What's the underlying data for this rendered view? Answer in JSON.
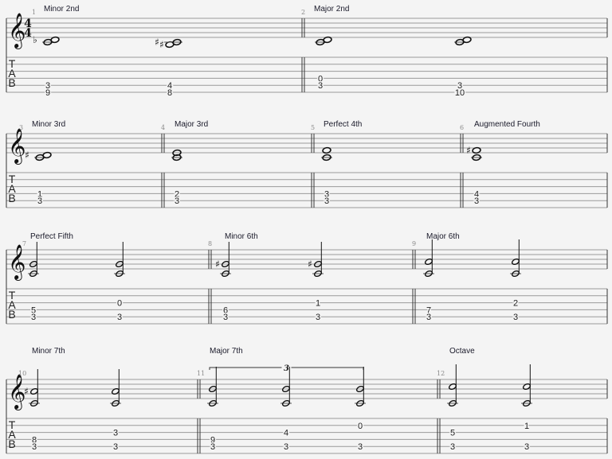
{
  "clef": "treble-clef-icon",
  "time_signature": {
    "top": "4",
    "bottom": "4"
  },
  "tab_letters": [
    "T",
    "A",
    "B"
  ],
  "measures": [
    {
      "number": "1",
      "label": "Minor 2nd",
      "duration": "whole",
      "chords": [
        {
          "notes": [
            "C4",
            "Db4"
          ],
          "frets": [
            {
              "string": 5,
              "fret": "3"
            },
            {
              "string": 6,
              "fret": "9"
            }
          ]
        },
        {
          "notes": [
            "B#3",
            "C#4"
          ],
          "frets": [
            {
              "string": 5,
              "fret": "4"
            },
            {
              "string": 6,
              "fret": "8"
            }
          ]
        }
      ]
    },
    {
      "number": "2",
      "label": "Major 2nd",
      "duration": "whole",
      "chords": [
        {
          "notes": [
            "C4",
            "D4"
          ],
          "frets": [
            {
              "string": 4,
              "fret": "0"
            },
            {
              "string": 5,
              "fret": "3"
            }
          ]
        },
        {
          "notes": [
            "C4",
            "D4"
          ],
          "frets": [
            {
              "string": 5,
              "fret": "3"
            },
            {
              "string": 6,
              "fret": "10"
            }
          ]
        }
      ]
    },
    {
      "number": "3",
      "label": "Minor 3rd",
      "duration": "whole",
      "chords": [
        {
          "notes": [
            "C4",
            "D#4"
          ],
          "frets": [
            {
              "string": 4,
              "fret": "1"
            },
            {
              "string": 5,
              "fret": "3"
            }
          ]
        }
      ]
    },
    {
      "number": "4",
      "label": "Major 3rd",
      "duration": "whole",
      "chords": [
        {
          "notes": [
            "C4",
            "E4"
          ],
          "frets": [
            {
              "string": 4,
              "fret": "2"
            },
            {
              "string": 5,
              "fret": "3"
            }
          ]
        }
      ]
    },
    {
      "number": "5",
      "label": "Perfect 4th",
      "duration": "whole",
      "chords": [
        {
          "notes": [
            "C4",
            "F4"
          ],
          "frets": [
            {
              "string": 4,
              "fret": "3"
            },
            {
              "string": 5,
              "fret": "3"
            }
          ]
        }
      ]
    },
    {
      "number": "6",
      "label": "Augmented Fourth",
      "duration": "whole",
      "chords": [
        {
          "notes": [
            "C4",
            "F#4"
          ],
          "frets": [
            {
              "string": 4,
              "fret": "4"
            },
            {
              "string": 5,
              "fret": "3"
            }
          ]
        }
      ]
    },
    {
      "number": "7",
      "label": "Perfect Fifth",
      "duration": "half",
      "chords": [
        {
          "notes": [
            "C4",
            "G4"
          ],
          "frets": [
            {
              "string": 4,
              "fret": "5"
            },
            {
              "string": 5,
              "fret": "3"
            }
          ]
        },
        {
          "notes": [
            "C4",
            "G4"
          ],
          "frets": [
            {
              "string": 3,
              "fret": "0"
            },
            {
              "string": 5,
              "fret": "3"
            }
          ]
        }
      ]
    },
    {
      "number": "8",
      "label": "Minor 6th",
      "duration": "half",
      "chords": [
        {
          "notes": [
            "C4",
            "G#4"
          ],
          "frets": [
            {
              "string": 4,
              "fret": "6"
            },
            {
              "string": 5,
              "fret": "3"
            }
          ]
        },
        {
          "notes": [
            "C4",
            "G#4"
          ],
          "frets": [
            {
              "string": 3,
              "fret": "1"
            },
            {
              "string": 5,
              "fret": "3"
            }
          ]
        }
      ]
    },
    {
      "number": "9",
      "label": "Major 6th",
      "duration": "half",
      "chords": [
        {
          "notes": [
            "C4",
            "A4"
          ],
          "frets": [
            {
              "string": 4,
              "fret": "7"
            },
            {
              "string": 5,
              "fret": "3"
            }
          ]
        },
        {
          "notes": [
            "C4",
            "A4"
          ],
          "frets": [
            {
              "string": 3,
              "fret": "2"
            },
            {
              "string": 5,
              "fret": "3"
            }
          ]
        }
      ]
    },
    {
      "number": "10",
      "label": "Minor 7th",
      "duration": "half",
      "chords": [
        {
          "notes": [
            "C4",
            "A#4"
          ],
          "frets": [
            {
              "string": 4,
              "fret": "8"
            },
            {
              "string": 5,
              "fret": "3"
            }
          ]
        },
        {
          "notes": [
            "C4",
            "A4"
          ],
          "frets": [
            {
              "string": 3,
              "fret": "3"
            },
            {
              "string": 5,
              "fret": "3"
            }
          ]
        }
      ]
    },
    {
      "number": "11",
      "label": "Major 7th",
      "duration": "half",
      "tuplet": "3",
      "chords": [
        {
          "notes": [
            "C4",
            "B4"
          ],
          "frets": [
            {
              "string": 4,
              "fret": "9"
            },
            {
              "string": 5,
              "fret": "3"
            }
          ]
        },
        {
          "notes": [
            "C4",
            "B4"
          ],
          "frets": [
            {
              "string": 3,
              "fret": "4"
            },
            {
              "string": 5,
              "fret": "3"
            }
          ]
        },
        {
          "notes": [
            "C4",
            "B4"
          ],
          "frets": [
            {
              "string": 2,
              "fret": "0"
            },
            {
              "string": 5,
              "fret": "3"
            }
          ]
        }
      ]
    },
    {
      "number": "12",
      "label": "Octave",
      "duration": "half",
      "chords": [
        {
          "notes": [
            "C4",
            "C5"
          ],
          "frets": [
            {
              "string": 3,
              "fret": "5"
            },
            {
              "string": 5,
              "fret": "3"
            }
          ]
        },
        {
          "notes": [
            "C4",
            "C5"
          ],
          "frets": [
            {
              "string": 2,
              "fret": "1"
            },
            {
              "string": 5,
              "fret": "3"
            }
          ]
        }
      ]
    }
  ]
}
